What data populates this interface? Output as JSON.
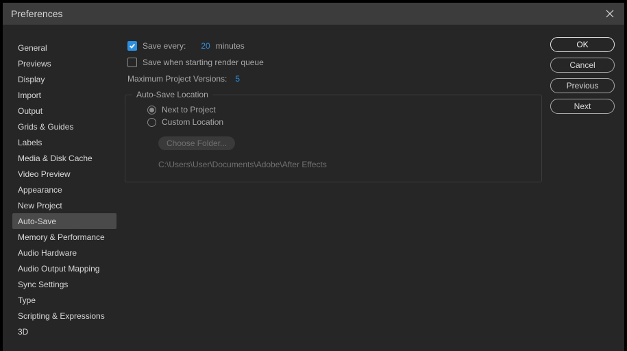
{
  "window": {
    "title": "Preferences"
  },
  "sidebar": {
    "items": [
      {
        "label": "General"
      },
      {
        "label": "Previews"
      },
      {
        "label": "Display"
      },
      {
        "label": "Import"
      },
      {
        "label": "Output"
      },
      {
        "label": "Grids & Guides"
      },
      {
        "label": "Labels"
      },
      {
        "label": "Media & Disk Cache"
      },
      {
        "label": "Video Preview"
      },
      {
        "label": "Appearance"
      },
      {
        "label": "New Project"
      },
      {
        "label": "Auto-Save"
      },
      {
        "label": "Memory & Performance"
      },
      {
        "label": "Audio Hardware"
      },
      {
        "label": "Audio Output Mapping"
      },
      {
        "label": "Sync Settings"
      },
      {
        "label": "Type"
      },
      {
        "label": "Scripting & Expressions"
      },
      {
        "label": "3D"
      }
    ],
    "selected_index": 11
  },
  "main": {
    "save_every_label": "Save every:",
    "save_every_value": "20",
    "save_every_unit": "minutes",
    "save_on_render_label": "Save when starting render queue",
    "max_versions_label": "Maximum Project Versions:",
    "max_versions_value": "5",
    "location_legend": "Auto-Save Location",
    "radio_next_to_project": "Next to Project",
    "radio_custom_location": "Custom Location",
    "choose_folder_label": "Choose Folder...",
    "path": "C:\\Users\\User\\Documents\\Adobe\\After Effects"
  },
  "actions": {
    "ok": "OK",
    "cancel": "Cancel",
    "previous": "Previous",
    "next": "Next"
  }
}
